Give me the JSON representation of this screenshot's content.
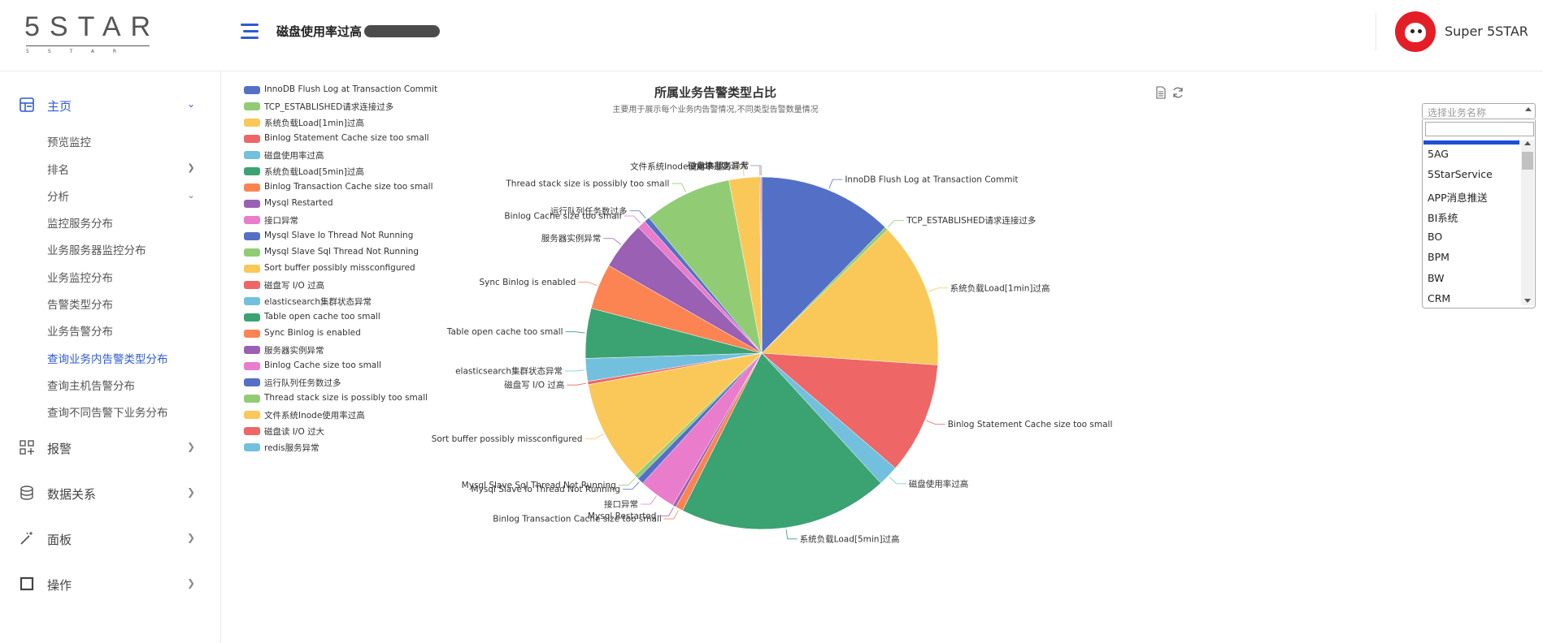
{
  "header": {
    "logo_main": "5STAR",
    "logo_sub": "5STAR",
    "title": "磁盘使用率过高",
    "username": "Super 5STAR"
  },
  "sidebar": {
    "home": {
      "label": "主页",
      "icon": "dashboard-icon"
    },
    "home_items": [
      {
        "label": "预览监控"
      },
      {
        "label": "排名"
      },
      {
        "label": "分析"
      },
      {
        "label": "监控服务分布"
      },
      {
        "label": "业务服务器监控分布"
      },
      {
        "label": "业务监控分布"
      },
      {
        "label": "告警类型分布"
      },
      {
        "label": "业务告警分布"
      },
      {
        "label": "查询业务内告警类型分布"
      },
      {
        "label": "查询主机告警分布"
      },
      {
        "label": "查询不同告警下业务分布"
      }
    ],
    "alarm": {
      "label": "报警",
      "icon": "grid-plus-icon"
    },
    "data_relation": {
      "label": "数据关系",
      "icon": "database-icon"
    },
    "panel": {
      "label": "面板",
      "icon": "magic-wand-icon"
    },
    "operation": {
      "label": "操作",
      "icon": "square-icon"
    }
  },
  "select": {
    "placeholder": "选择业务名称",
    "options": [
      "5AG",
      "5StarService",
      "APP消息推送",
      "BI系统",
      "BO",
      "BPM",
      "BW",
      "CRM"
    ]
  },
  "chart_data": {
    "type": "pie",
    "title": "所属业务告警类型占比",
    "subtitle": "主要用于展示每个业务内告警情况,不同类型告警数量情况",
    "legend_position": "left",
    "slices": [
      {
        "name": "InnoDB Flush Log at Transaction Commit",
        "value": 12.4,
        "color": "#5470c6"
      },
      {
        "name": "TCP_ESTABLISHED请求连接过多",
        "value": 0.3,
        "color": "#91cc75"
      },
      {
        "name": "系统负载Load[1min]过高",
        "value": 13.5,
        "color": "#fac858"
      },
      {
        "name": "Binlog Statement Cache size too small",
        "value": 10.3,
        "color": "#ee6666"
      },
      {
        "name": "磁盘使用率过高",
        "value": 1.9,
        "color": "#73c0de"
      },
      {
        "name": "系统负载Load[5min]过高",
        "value": 19.3,
        "color": "#3ba272"
      },
      {
        "name": "Binlog Transaction Cache size too small",
        "value": 0.7,
        "color": "#fc8452"
      },
      {
        "name": "Mysql Restarted",
        "value": 0.3,
        "color": "#9a60b4"
      },
      {
        "name": "接口异常",
        "value": 3.4,
        "color": "#ea7ccc"
      },
      {
        "name": "Mysql Slave Io Thread Not Running",
        "value": 0.6,
        "color": "#5470c6"
      },
      {
        "name": "Mysql Slave Sql Thread Not Running",
        "value": 0.4,
        "color": "#91cc75"
      },
      {
        "name": "Sort buffer possibly missconfigured",
        "value": 9.4,
        "color": "#fac858"
      },
      {
        "name": "磁盘写 I/O 过高",
        "value": 0.3,
        "color": "#ee6666"
      },
      {
        "name": "elasticsearch集群状态异常",
        "value": 2.1,
        "color": "#73c0de"
      },
      {
        "name": "Table open cache too small",
        "value": 4.6,
        "color": "#3ba272"
      },
      {
        "name": "Sync Binlog is enabled",
        "value": 4.2,
        "color": "#fc8452"
      },
      {
        "name": "服务器实例异常",
        "value": 4.4,
        "color": "#9a60b4"
      },
      {
        "name": "Binlog Cache size too small",
        "value": 0.8,
        "color": "#ea7ccc"
      },
      {
        "name": "运行队列任务数过多",
        "value": 0.5,
        "color": "#5470c6"
      },
      {
        "name": "Thread stack size is possibly too small",
        "value": 8.1,
        "color": "#91cc75"
      },
      {
        "name": "文件系统Inode使用率过高",
        "value": 2.8,
        "color": "#fac858"
      },
      {
        "name": "磁盘读 I/O 过大",
        "value": 0.1,
        "color": "#ee6666"
      },
      {
        "name": "redis服务异常",
        "value": 0.1,
        "color": "#73c0de"
      }
    ]
  }
}
